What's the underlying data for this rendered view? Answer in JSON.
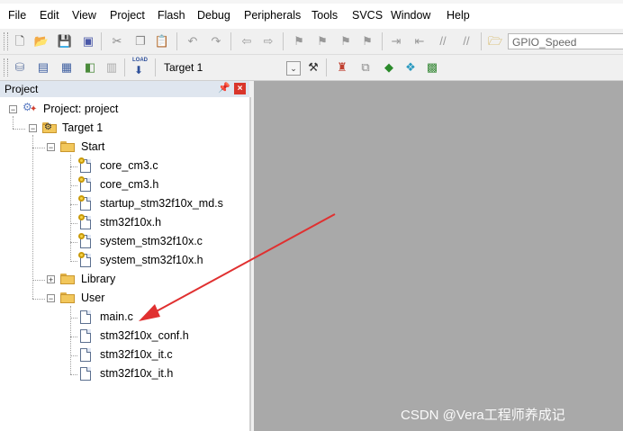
{
  "menu": {
    "items": [
      "File",
      "Edit",
      "View",
      "Project",
      "Flash",
      "Debug",
      "Peripherals",
      "Tools",
      "SVCS",
      "Window",
      "Help"
    ]
  },
  "toolbar1": {
    "find_value": "GPIO_Speed"
  },
  "toolbar2": {
    "target_value": "Target 1",
    "load_label": "LOAD"
  },
  "project_pane": {
    "title": "Project",
    "pin_icon": "pin-icon",
    "close_icon": "close-icon"
  },
  "tree": {
    "project": "Project: project",
    "target": "Target 1",
    "groups": [
      {
        "name": "Start",
        "expanded": true,
        "files": [
          "core_cm3.c",
          "core_cm3.h",
          "startup_stm32f10x_md.s",
          "stm32f10x.h",
          "system_stm32f10x.c",
          "system_stm32f10x.h"
        ]
      },
      {
        "name": "Library",
        "expanded": false,
        "files": []
      },
      {
        "name": "User",
        "expanded": true,
        "files": [
          "main.c",
          "stm32f10x_conf.h",
          "stm32f10x_it.c",
          "stm32f10x_it.h"
        ]
      }
    ]
  },
  "annotation": {
    "arrow_color": "#e03030",
    "points_to": "main.c"
  },
  "watermark": "CSDN @Vera工程师养成记",
  "colors": {
    "editor_background": "#a9a9a9",
    "pane_header": "#dfe6ef",
    "close_button": "#d9352b"
  }
}
